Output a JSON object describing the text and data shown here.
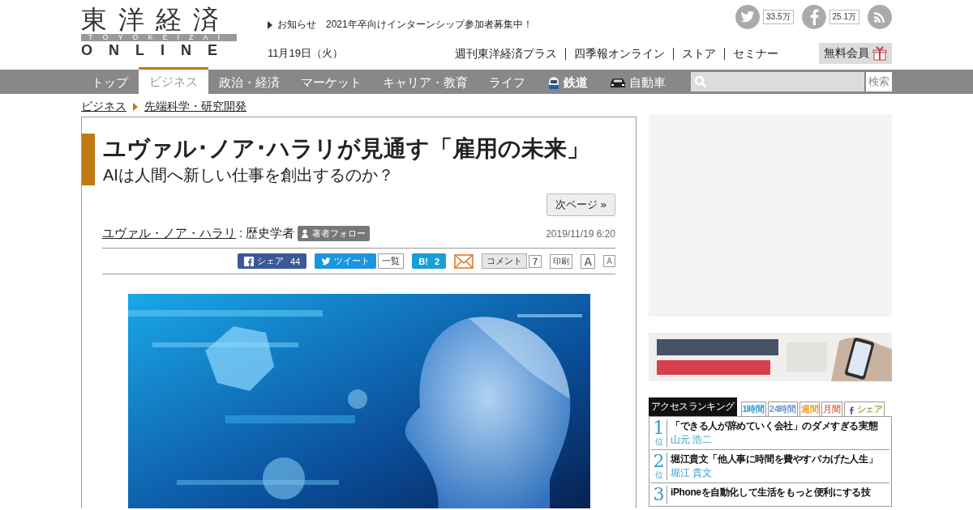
{
  "header": {
    "logo": {
      "kanji": "東洋経済",
      "romaji": "TOYOKEIZAI",
      "online": "ONLINE"
    },
    "notice": {
      "label": "お知らせ",
      "text": "2021年卒向けインターンシップ参加者募集中！"
    },
    "date": "11月19日（火）",
    "social": [
      {
        "kind": "twitter",
        "count": "33.5万"
      },
      {
        "kind": "facebook",
        "count": "25.1万"
      },
      {
        "kind": "rss"
      }
    ],
    "links": [
      "週刊東洋経済プラス",
      "四季報オンライン",
      "ストア",
      "セミナー"
    ],
    "member_button": "無料会員"
  },
  "nav": {
    "items": [
      {
        "label": "トップ",
        "kind": "text",
        "selected": false
      },
      {
        "label": "ビジネス",
        "kind": "text",
        "selected": true
      },
      {
        "label": "政治・経済",
        "kind": "text",
        "selected": false
      },
      {
        "label": "マーケット",
        "kind": "text",
        "selected": false
      },
      {
        "label": "キャリア・教育",
        "kind": "text",
        "selected": false
      },
      {
        "label": "ライフ",
        "kind": "text",
        "selected": false
      },
      {
        "label": "鉄道",
        "kind": "train",
        "selected": false
      },
      {
        "label": "自動車",
        "kind": "car",
        "selected": false
      }
    ],
    "search_button": "検索"
  },
  "breadcrumb": [
    "ビジネス",
    "先端科学・研究開発"
  ],
  "article": {
    "title": "ユヴァル･ノア･ハラリが見通す「雇用の未来」",
    "subtitle": "AIは人間へ新しい仕事を創出するのか？",
    "next_page": "次ページ »",
    "author": "ユヴァル・ノア・ハラリ",
    "author_role": ": 歴史学者",
    "follow": "著者フォロー",
    "date": "2019/11/19 6:20",
    "share": {
      "facebook": "シェア",
      "facebook_count": "44",
      "tweet": "ツイート",
      "list": "一覧",
      "hatena": "B!",
      "hatena_count": "2",
      "comment": "コメント",
      "comment_count": "7",
      "print": "印刷",
      "font_large": "A",
      "font_small": "A"
    }
  },
  "ranking": {
    "title": "アクセスランキング",
    "tabs": [
      {
        "label": "1時間",
        "kind": "text",
        "color": "#3399cc"
      },
      {
        "label": "24時間",
        "kind": "text",
        "color": "#6b9bd0"
      },
      {
        "label": "週間",
        "kind": "text",
        "color": "#f0a030"
      },
      {
        "label": "月間",
        "kind": "text",
        "color": "#e8735a"
      },
      {
        "label": "シェア",
        "kind": "facebook",
        "color": "#99b440"
      }
    ],
    "items": [
      {
        "rank": "1",
        "unit": "位",
        "title": "「できる人が辞めていく会社」のダメすぎる実態",
        "author": "山元 浩二"
      },
      {
        "rank": "2",
        "unit": "位",
        "title": "堀江貴文「他人事に時間を費やすバカげた人生」",
        "author": "堀江 貴文"
      },
      {
        "rank": "3",
        "title": "iPhoneを自動化して生活をもっと便利にする技"
      }
    ]
  }
}
